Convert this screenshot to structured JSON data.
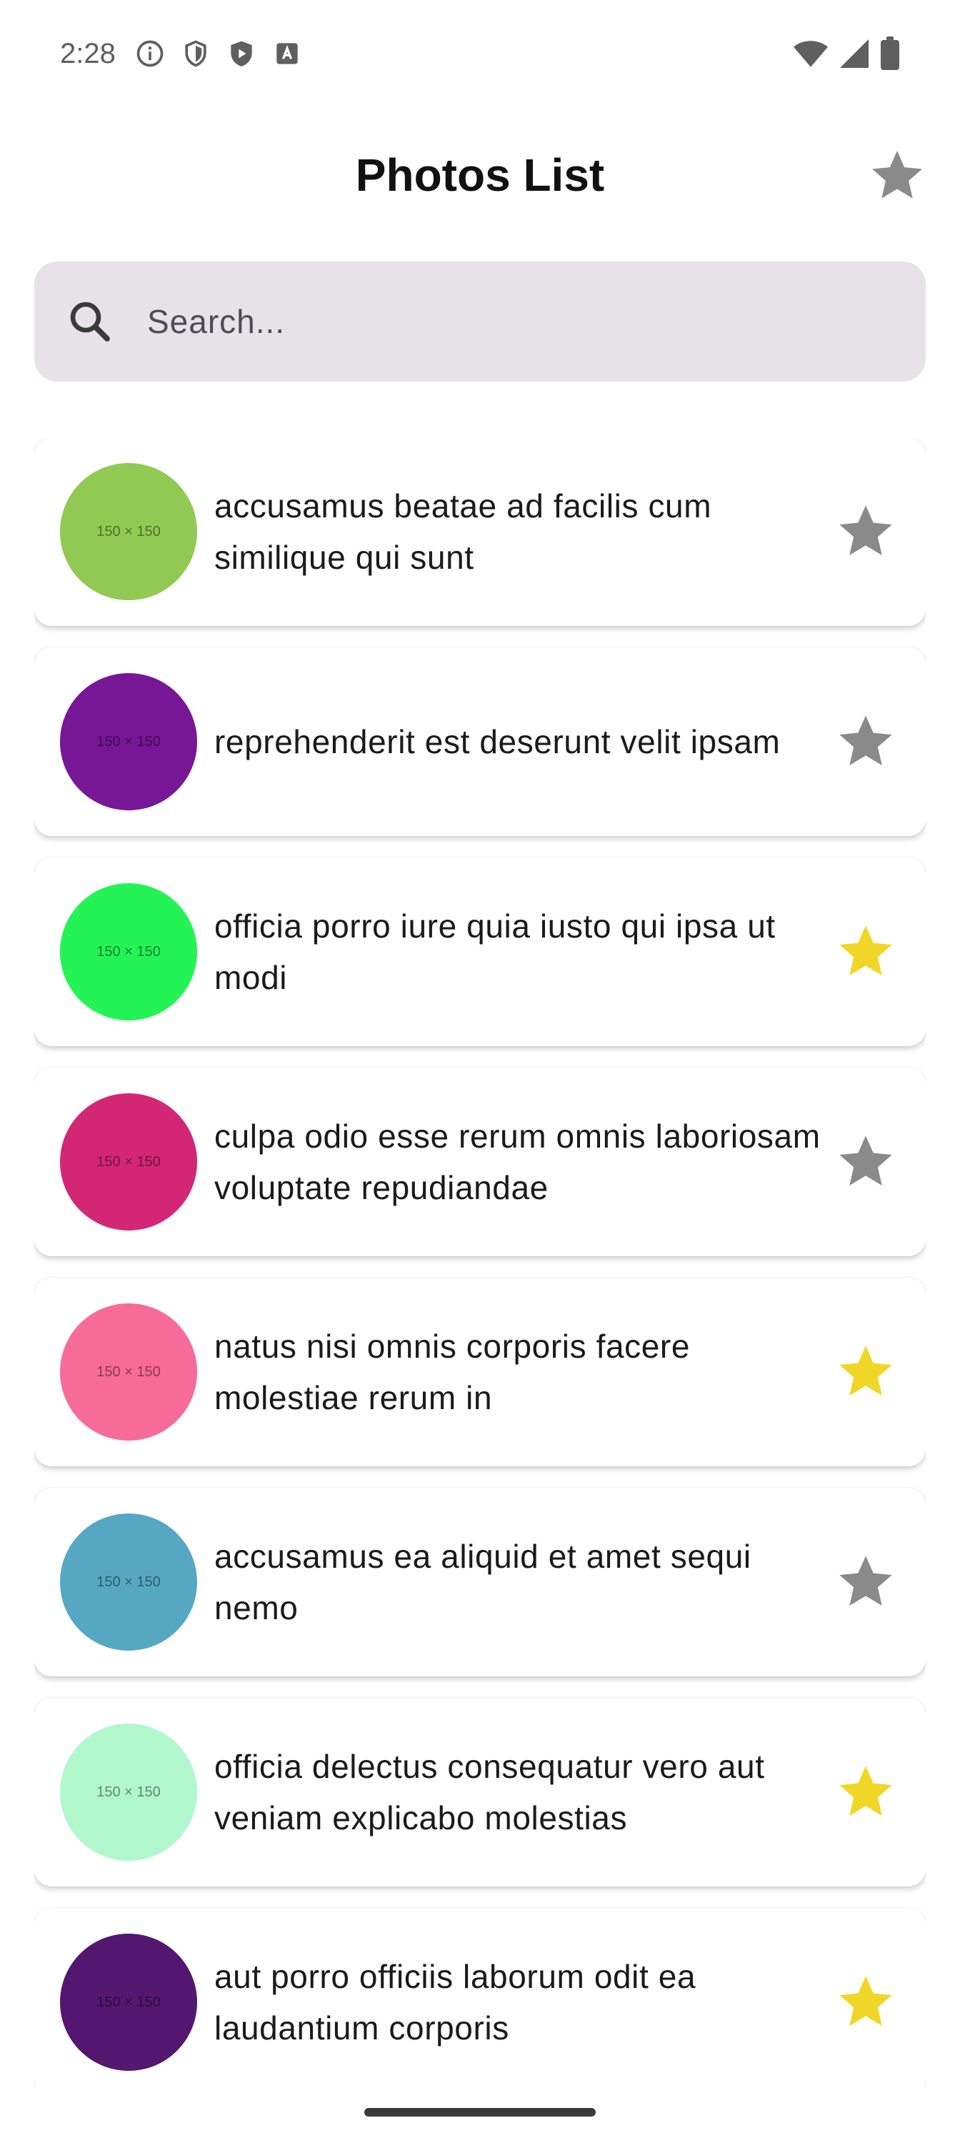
{
  "status_bar": {
    "time": "2:28",
    "icons": [
      "info-icon",
      "shield-icon",
      "play-protect-icon",
      "keyboard-a-icon",
      "wifi-icon",
      "signal-icon",
      "battery-icon"
    ]
  },
  "app_bar": {
    "title": "Photos List",
    "favorites_icon": "star-icon",
    "favorites_color": "#8a8a8a"
  },
  "search": {
    "placeholder": "Search...",
    "value": "",
    "icon": "search-icon"
  },
  "colors": {
    "star_on": "#f0d727",
    "star_off": "#8a8a8a",
    "search_bg": "#e7e1e8"
  },
  "photos": [
    {
      "title": "accusamus beatae ad facilis cum similique qui sunt",
      "thumb_label": "150 × 150",
      "thumb_color": "#92c952",
      "favorite": false
    },
    {
      "title": "reprehenderit est deserunt velit ipsam",
      "thumb_label": "150 × 150",
      "thumb_color": "#771796",
      "favorite": false
    },
    {
      "title": "officia porro iure quia iusto qui ipsa ut modi",
      "thumb_label": "150 × 150",
      "thumb_color": "#24f355",
      "favorite": true
    },
    {
      "title": "culpa odio esse rerum omnis laboriosam voluptate repudiandae",
      "thumb_label": "150 × 150",
      "thumb_color": "#d32776",
      "favorite": false
    },
    {
      "title": "natus nisi omnis corporis facere molestiae rerum in",
      "thumb_label": "150 × 150",
      "thumb_color": "#f66b97",
      "favorite": true
    },
    {
      "title": "accusamus ea aliquid et amet sequi nemo",
      "thumb_label": "150 × 150",
      "thumb_color": "#56a8c2",
      "favorite": false
    },
    {
      "title": "officia delectus consequatur vero aut veniam explicabo molestias",
      "thumb_label": "150 × 150",
      "thumb_color": "#b0f7cc",
      "favorite": true
    },
    {
      "title": "aut porro officiis laborum odit ea laudantium corporis",
      "thumb_label": "150 × 150",
      "thumb_color": "#54176f",
      "favorite": true
    }
  ]
}
